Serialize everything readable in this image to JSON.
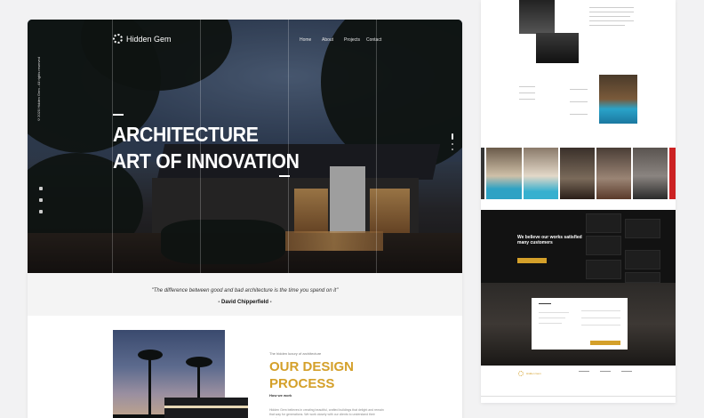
{
  "brand": {
    "name": "Hidden Gem"
  },
  "nav": {
    "items": [
      "Home",
      "About",
      "Projects",
      "Contact"
    ]
  },
  "hero": {
    "side_note": "©2020 Hidden Gem - All rights reserved",
    "title_line1": "ARCHITECTURE",
    "title_line2": "ART OF INNOVATION"
  },
  "quote": {
    "text": "\"The difference between good and bad architecture is the time you spend on it\"",
    "author": "- David Chipperfield -"
  },
  "design": {
    "kicker": "The hidden luxury of architecture",
    "title_line1": "OUR DESIGN",
    "title_line2": "PROCESS",
    "subtitle": "How we work",
    "body": "Hidden Gem believes in creating beautiful, crafted buildings that delight and remain that way for generations. We work closely with our clients to understand their needs."
  },
  "side": {
    "dark_title_line1": "We believe our works satisfied",
    "dark_title_line2": "many customers",
    "footer_brand": "Hidden Gem"
  },
  "colors": {
    "accent": "#d4a02a",
    "dark": "#121212"
  }
}
